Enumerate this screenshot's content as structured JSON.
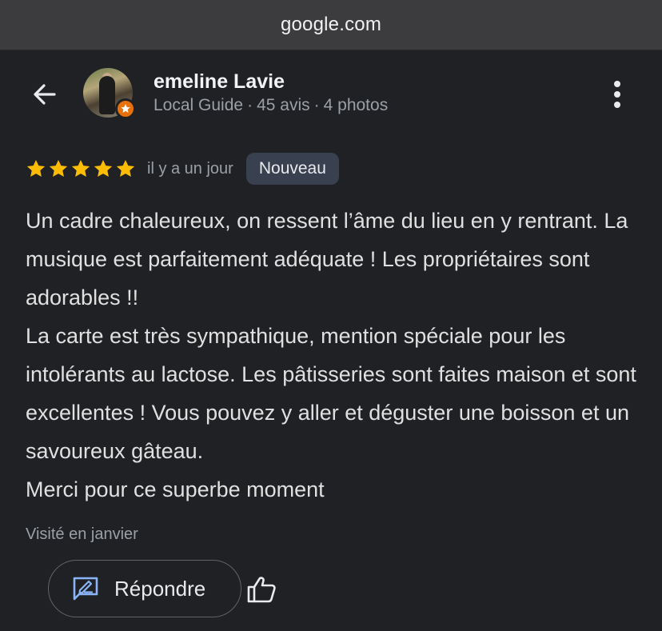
{
  "browser": {
    "url": "google.com"
  },
  "header": {
    "reviewer_name": "emeline Lavie",
    "guide_label": "Local Guide",
    "reviews_count": "45 avis",
    "photos_count": "4 photos",
    "separator": "·"
  },
  "rating": {
    "stars": 5,
    "time_ago": "il y a un jour",
    "new_badge": "Nouveau",
    "star_color": "#fbbc04"
  },
  "review": {
    "paragraphs": [
      "Un cadre chaleureux, on ressent l’âme du lieu en y rentrant. La musique est parfaitement adéquate ! Les propriétaires sont adorables !!",
      "La carte est très sympathique, mention spéciale pour les intolérants au lactose. Les pâtisseries sont faites maison et sont excellentes ! Vous pouvez y aller et déguster une boisson et un savoureux gâteau.",
      "Merci pour ce superbe moment"
    ]
  },
  "visited": "Visité en janvier",
  "actions": {
    "reply_label": "Répondre",
    "reply_icon": "reply-edit-icon",
    "like_icon": "thumbs-up-icon",
    "accent_color": "#8ab4f8"
  }
}
